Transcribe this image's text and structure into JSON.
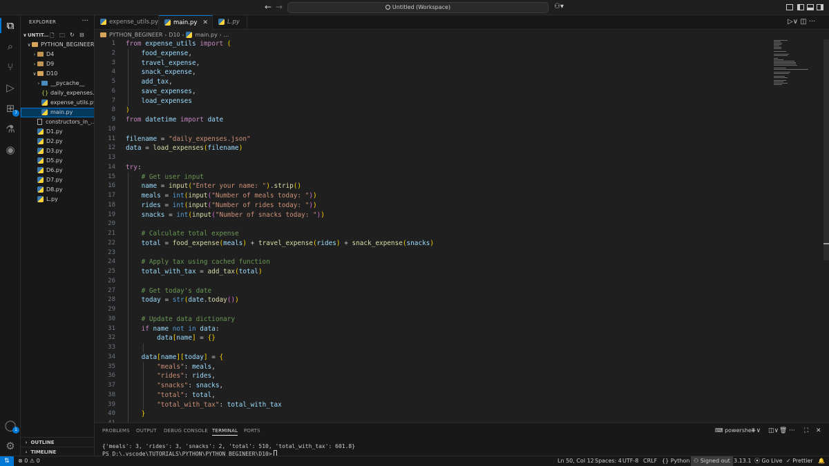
{
  "titlebar": {
    "search_text": "Untitled (Workspace)"
  },
  "explorer": {
    "header": "EXPLORER",
    "more": "···",
    "workspace": "UNTIT...",
    "root": "PYTHON_BEGINEER",
    "items": [
      {
        "label": "D4",
        "type": "folder"
      },
      {
        "label": "D9",
        "type": "folder"
      },
      {
        "label": "D10",
        "type": "folder-open"
      },
      {
        "label": "__pycache__",
        "type": "pycache"
      },
      {
        "label": "daily_expenses....",
        "type": "json"
      },
      {
        "label": "expense_utils.py",
        "type": "py"
      },
      {
        "label": "main.py",
        "type": "py"
      },
      {
        "label": "constructors_in_...",
        "type": "file"
      },
      {
        "label": "D1.py",
        "type": "py"
      },
      {
        "label": "D2.py",
        "type": "py"
      },
      {
        "label": "D3.py",
        "type": "py"
      },
      {
        "label": "D5.py",
        "type": "py"
      },
      {
        "label": "D6.py",
        "type": "py"
      },
      {
        "label": "D7.py",
        "type": "py"
      },
      {
        "label": "D8.py",
        "type": "py"
      },
      {
        "label": "L.py",
        "type": "py"
      }
    ],
    "outline": "OUTLINE",
    "timeline": "TIMELINE"
  },
  "activity": {
    "extensions_badge": "7",
    "accounts_badge": "1"
  },
  "tabs": [
    {
      "label": "expense_utils.py"
    },
    {
      "label": "main.py",
      "close": "✕"
    },
    {
      "label": "L.py"
    }
  ],
  "breadcrumb": {
    "root": "PYTHON_BEGINEER",
    "folder": "D10",
    "file": "main.py",
    "tail": "..."
  },
  "panel": {
    "tabs": [
      "PROBLEMS",
      "OUTPUT",
      "DEBUG CONSOLE",
      "TERMINAL",
      "PORTS"
    ],
    "shell": "powershell",
    "output": "{'meals': 3, 'rides': 3, 'snacks': 2, 'total': 510, 'total_with_tax': 601.8}",
    "prompt": "PS D:\\.vscode\\TUTORIALS\\PYTHON\\PYTHON_BEGINEER\\D10>"
  },
  "status": {
    "errors": "0",
    "warnings": "0",
    "position": "Ln 50, Col 12",
    "spaces": "Spaces: 4",
    "encoding": "UTF-8",
    "eol": "CRLF",
    "language": "Python",
    "account": "Signed out",
    "version": "3.13.1",
    "golive": "Go Live",
    "prettier": "Prettier"
  },
  "colors": {
    "accent": "#0078d4",
    "keyword": "#569cd6",
    "control": "#c586c0",
    "string": "#ce9178",
    "function": "#dcdcaa",
    "variable": "#9cdcfe",
    "comment": "#6a9955"
  }
}
